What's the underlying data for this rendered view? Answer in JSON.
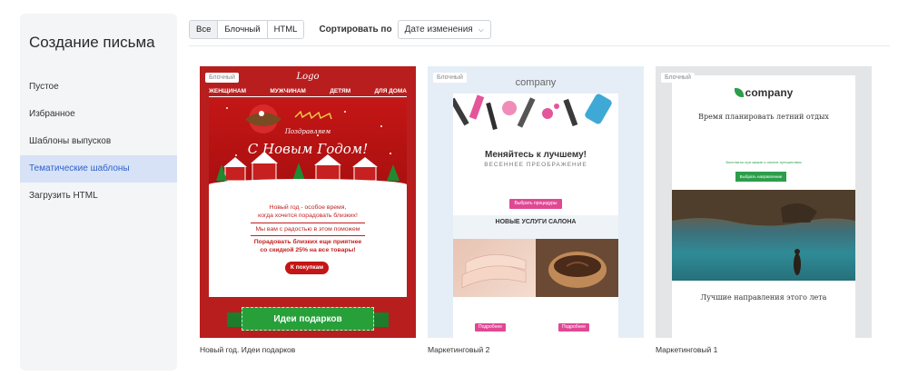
{
  "sidebar": {
    "title": "Создание письма",
    "items": [
      {
        "label": "Пустое"
      },
      {
        "label": "Избранное"
      },
      {
        "label": "Шаблоны выпусков"
      },
      {
        "label": "Тематические шаблоны"
      },
      {
        "label": "Загрузить HTML"
      }
    ],
    "active_index": 3
  },
  "toolbar": {
    "filters": [
      {
        "label": "Все"
      },
      {
        "label": "Блочный"
      },
      {
        "label": "HTML"
      }
    ],
    "sort_label": "Сортировать по",
    "sort_value": "Дате изменения"
  },
  "cards": [
    {
      "badge": "Блочный",
      "caption": "Новый год. Идеи подарков",
      "preview": {
        "logo": "Logo",
        "menu": [
          "ЖЕНЩИНАМ",
          "МУЖЧИНАМ",
          "ДЕТЯМ",
          "ДЛЯ ДОМА"
        ],
        "pre": "Поздравляем",
        "headline": "С Новым Годом!",
        "line1": "Новый год - особое время,",
        "line2": "когда хочется порадовать близких!",
        "line3": "Мы вам с радостью в этом поможем",
        "line4": "Порадовать близких еще приятнее",
        "line5": "со скидкой 25% на все товары!",
        "button": "К покупкам",
        "ribbon": "Идеи подарков"
      }
    },
    {
      "badge": "Блочный",
      "caption": "Маркетинговый 2",
      "preview": {
        "logo": "company",
        "title": "Меняйтесь к лучшему!",
        "subtitle": "ВЕСЕННЕЕ ПРЕОБРАЖЕНИЕ",
        "button": "Выбрать процедуры",
        "band_title": "НОВЫЕ УСЛУГИ САЛОНА",
        "btn_left": "Подробнее",
        "btn_right": "Подробнее"
      }
    },
    {
      "badge": "Блочный",
      "caption": "Маркетинговый 1",
      "preview": {
        "logo": "company",
        "headline": "Время планировать летний отдых",
        "green_text": "Бесплатно при заказе и оплате путешествия",
        "button": "Выбрать направление",
        "headline2": "Лучшие направления этого лета"
      }
    }
  ],
  "colors": {
    "accent": "#2f61c9",
    "active_bg": "#d7e2f7",
    "card1_bg": "#b81e1e",
    "pink": "#e04894",
    "green": "#2c9e4b"
  }
}
